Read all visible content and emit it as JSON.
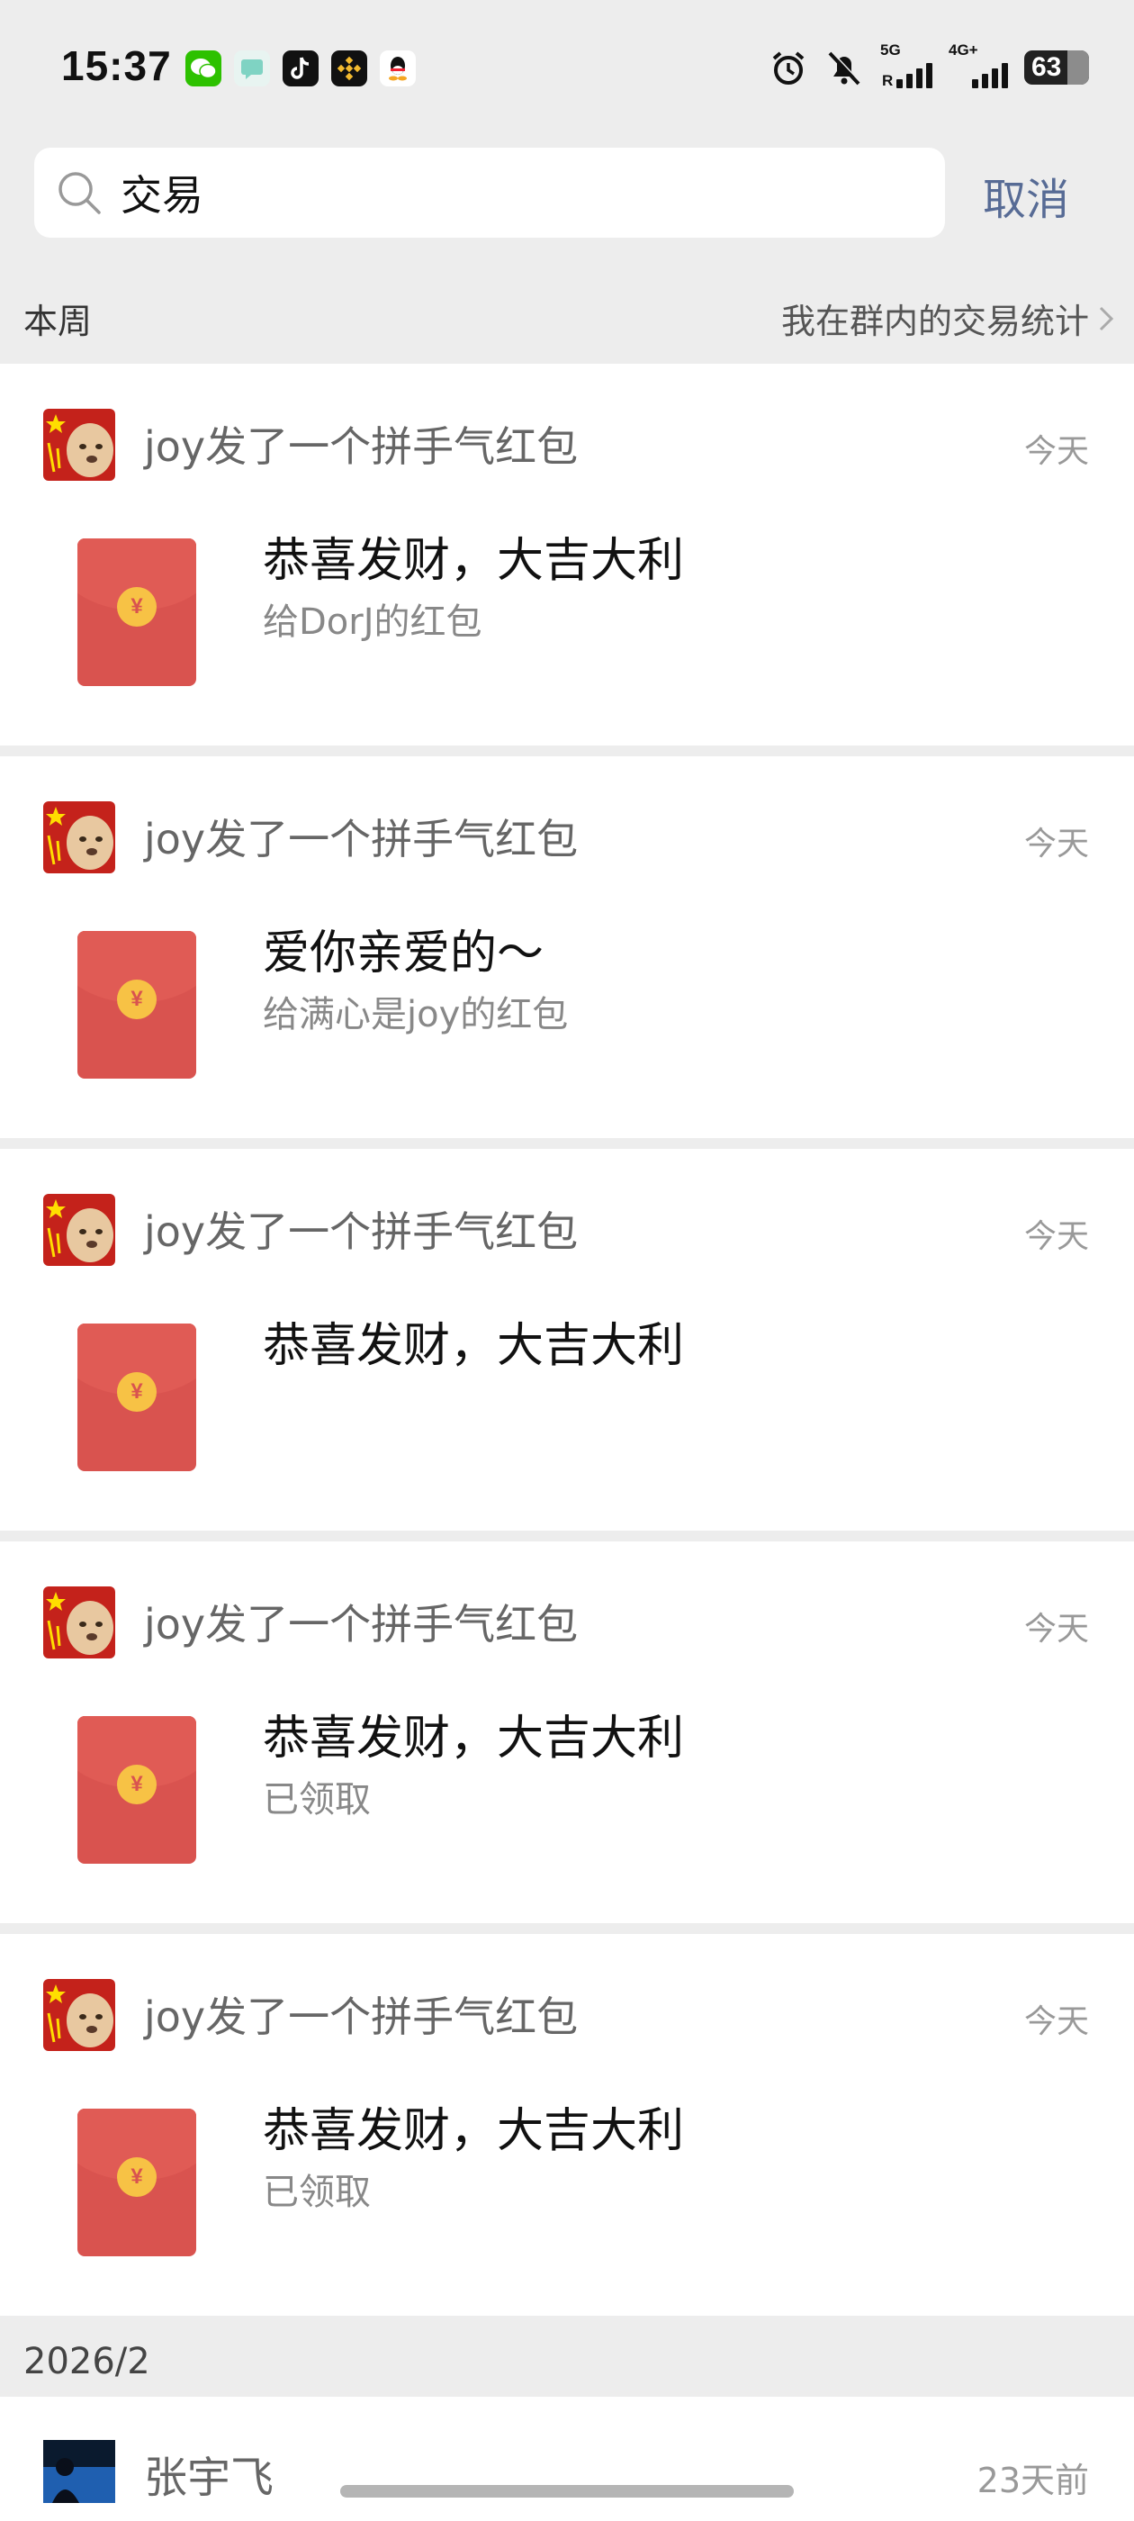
{
  "status_bar": {
    "time": "15:37",
    "apps": [
      "wechat-icon",
      "message-icon",
      "tiktok-icon",
      "binance-icon",
      "qq-icon"
    ],
    "network_5g": "5G",
    "network_5g_sub": "R",
    "network_4g": "4G+",
    "battery": "63"
  },
  "search": {
    "value": "交易",
    "cancel_label": "取消"
  },
  "week": {
    "label": "本周",
    "stats_link": "我在群内的交易统计"
  },
  "items": [
    {
      "title": "joy发了一个拼手气红包",
      "time": "今天",
      "main": "恭喜发财，大吉大利",
      "sub": "给DorJ的红包"
    },
    {
      "title": "joy发了一个拼手气红包",
      "time": "今天",
      "main": "爱你亲爱的～",
      "sub": "给满心是joy的红包"
    },
    {
      "title": "joy发了一个拼手气红包",
      "time": "今天",
      "main": "恭喜发财，大吉大利",
      "sub": ""
    },
    {
      "title": "joy发了一个拼手气红包",
      "time": "今天",
      "main": "恭喜发财，大吉大利",
      "sub": "已领取"
    },
    {
      "title": "joy发了一个拼手气红包",
      "time": "今天",
      "main": "恭喜发财，大吉大利",
      "sub": "已领取"
    }
  ],
  "coin_symbol": "¥",
  "date_section": {
    "label": "2026/2",
    "person_name": "张宇飞",
    "person_time": "23天前"
  },
  "colors": {
    "background": "#ededed",
    "link": "#576b95",
    "envelope": "#d9534f",
    "coin": "#f7c245"
  }
}
